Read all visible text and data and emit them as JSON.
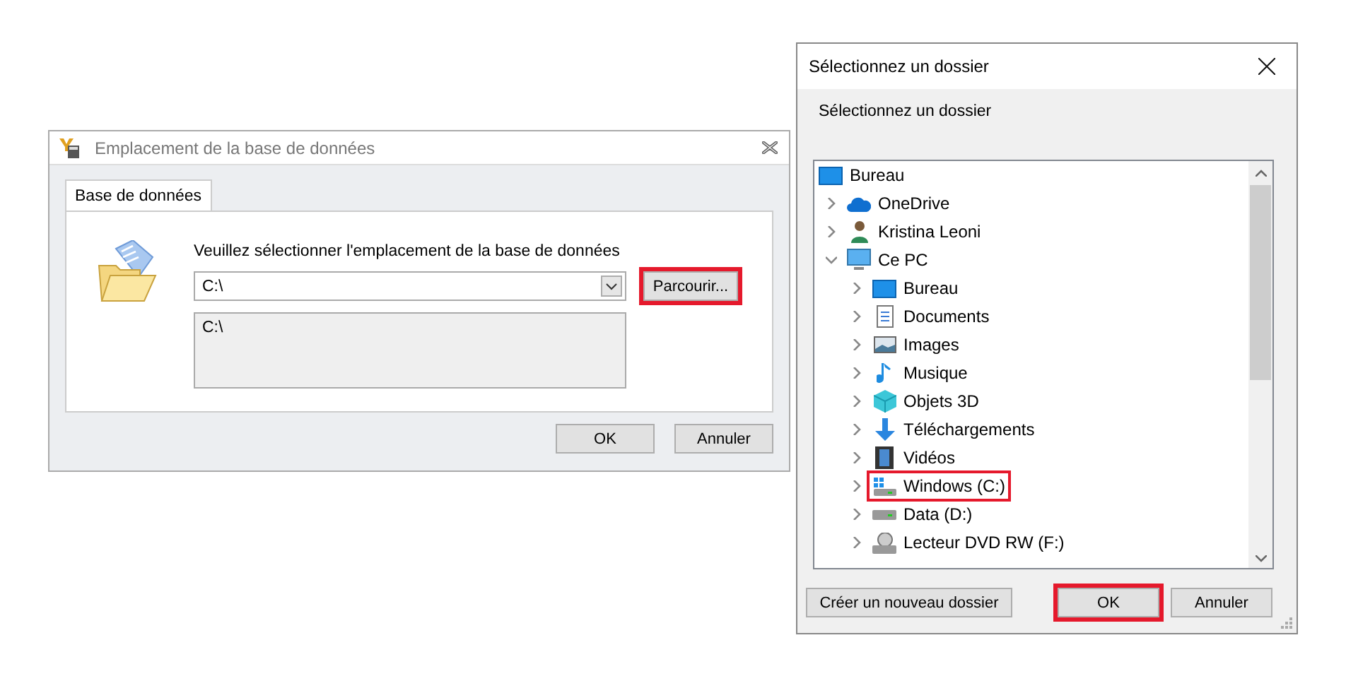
{
  "db_dialog": {
    "title": "Emplacement de la base de données",
    "tabs": [
      {
        "label": "Base de données",
        "selected": true
      }
    ],
    "prompt": "Veuillez sélectionner l'emplacement de la base de données",
    "path_combo": {
      "value": "C:\\"
    },
    "browse_button": {
      "label": "Parcourir...",
      "highlighted": true
    },
    "path_preview": "C:\\",
    "buttons": [
      {
        "label": "OK",
        "highlighted": false
      },
      {
        "label": "Annuler",
        "highlighted": false
      }
    ]
  },
  "folder_dialog": {
    "title": "Sélectionnez un dossier",
    "prompt": "Sélectionnez un dossier",
    "tree": [
      {
        "label": "Bureau",
        "kind": "desktop",
        "highlighted": false,
        "children": [
          {
            "label": "OneDrive",
            "kind": "cloud",
            "expanded": false,
            "highlighted": false
          },
          {
            "label": "Kristina Leoni",
            "kind": "person",
            "expanded": false,
            "highlighted": false
          },
          {
            "label": "Ce PC",
            "kind": "pc",
            "expanded": true,
            "highlighted": false,
            "children": [
              {
                "label": "Bureau",
                "kind": "desktop",
                "expanded": false,
                "highlighted": false
              },
              {
                "label": "Documents",
                "kind": "document",
                "expanded": false,
                "highlighted": false
              },
              {
                "label": "Images",
                "kind": "picture",
                "expanded": false,
                "highlighted": false
              },
              {
                "label": "Musique",
                "kind": "music",
                "expanded": false,
                "highlighted": false
              },
              {
                "label": "Objets 3D",
                "kind": "cube",
                "expanded": false,
                "highlighted": false
              },
              {
                "label": "Téléchargements",
                "kind": "download",
                "expanded": false,
                "highlighted": false
              },
              {
                "label": "Vidéos",
                "kind": "film",
                "expanded": false,
                "highlighted": false
              },
              {
                "label": "Windows (C:)",
                "kind": "windrive",
                "expanded": false,
                "highlighted": true
              },
              {
                "label": "Data (D:)",
                "kind": "drive",
                "expanded": false,
                "highlighted": false
              },
              {
                "label": "Lecteur DVD RW (F:)",
                "kind": "dvd",
                "expanded": false,
                "highlighted": false
              }
            ]
          }
        ]
      }
    ],
    "buttons": [
      {
        "label": "Créer un nouveau dossier",
        "highlighted": false
      },
      {
        "label": "OK",
        "highlighted": true
      },
      {
        "label": "Annuler",
        "highlighted": false
      }
    ]
  }
}
